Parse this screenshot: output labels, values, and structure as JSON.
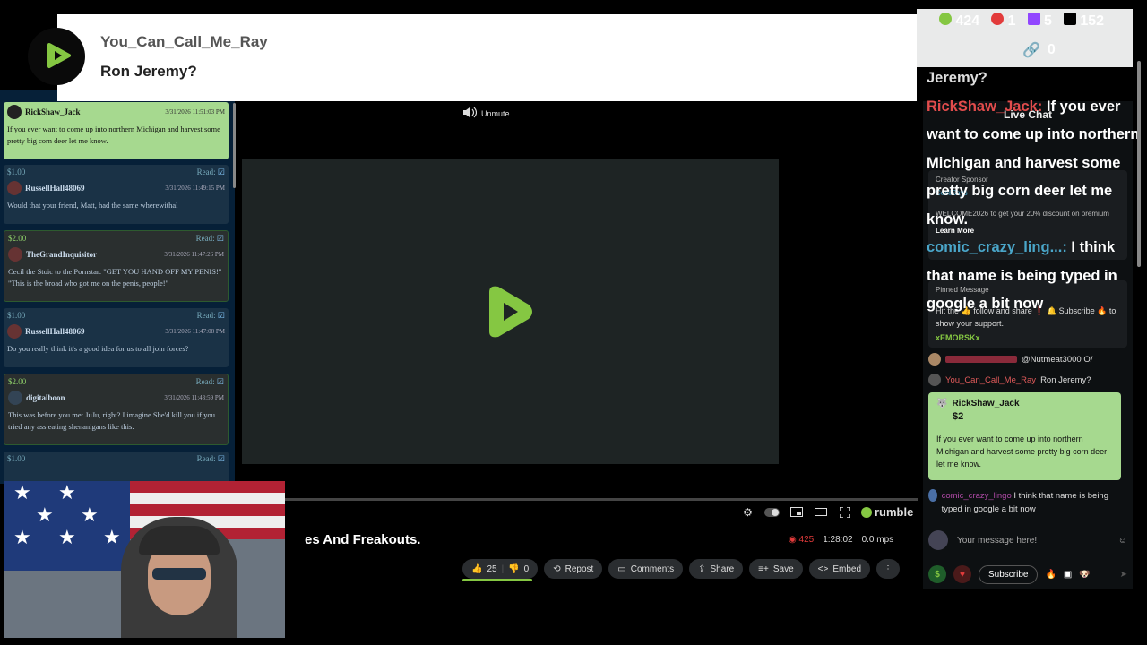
{
  "banner": {
    "username": "You_Can_Call_Me_Ray",
    "message": "Ron Jeremy?"
  },
  "top_stats": {
    "rumble_count": "424",
    "live_count": "1",
    "twitch_count": "5",
    "x_count": "152",
    "link_count": "0",
    "colors": {
      "rumble": "#85c742",
      "live": "#e23b3b",
      "twitch": "#9146ff",
      "x": "#000000"
    }
  },
  "player": {
    "unmute_label": "Unmute",
    "brand": "rumble",
    "title_partial": "es And Freakouts.",
    "viewers": "425",
    "duration": "1:28:02",
    "bitrate": "0.0 mps",
    "likes": "25",
    "dislikes": "0",
    "actions": [
      "Repost",
      "Comments",
      "Share",
      "Save",
      "Embed"
    ]
  },
  "donations": [
    {
      "amount": "$2.00",
      "user": "RickShaw_Jack",
      "time": "3/31/2026 11:51:03 PM",
      "message": "If you ever want to come up into northern Michigan and harvest some pretty big corn deer let me know.",
      "read": "",
      "style": "active"
    },
    {
      "amount": "$1.00",
      "user": "RussellHall48069",
      "time": "3/31/2026 11:49:15 PM",
      "message": "Would that your friend, Matt, had the same wherewithal",
      "read": "Read:",
      "style": "blue"
    },
    {
      "amount": "$2.00",
      "user": "TheGrandInquisitor",
      "time": "3/31/2026 11:47:26 PM",
      "message": "Cecil the Stoic to the Pornstar: \"GET YOU HAND OFF MY PENIS!\" \"This is the broad who got me on the penis, people!\"",
      "read": "Read:",
      "style": "green"
    },
    {
      "amount": "$1.00",
      "user": "RussellHall48069",
      "time": "3/31/2026 11:47:08 PM",
      "message": "Do you really think it's a good idea for us to all join forces?",
      "read": "Read:",
      "style": "blue"
    },
    {
      "amount": "$2.00",
      "user": "digitalboon",
      "time": "3/31/2026 11:43:59 PM",
      "message": "This was before you met JuJu, right? I imagine She'd kill you if you tried any ass eating shenanigans like this.",
      "read": "Read:",
      "style": "green"
    },
    {
      "amount": "$1.00",
      "user": "",
      "time": "",
      "message": "",
      "read": "Read:",
      "style": "blue"
    }
  ],
  "chat": {
    "header": "Live Chat",
    "sponsor_label": "Creator Sponsor",
    "sponsor_user": "CecilSays",
    "sponsor_text": "WELCOME2026 to get your 20% discount on premium",
    "sponsor_learn": "Learn More",
    "pinned_label": "Pinned Message",
    "pinned_text": "Hit the 👍 follow and share ❗ 🔔 Subscribe 🔥 to show your support.",
    "pinned_user": "xEMORSKx",
    "line1_text": "@Nutmeat3000 O/",
    "line2_user": "You_Can_Call_Me_Ray",
    "line2_text": "Ron Jeremy?",
    "rant_user": "RickShaw_Jack",
    "rant_amount": "$2",
    "rant_message": "If you ever want to come up into northern Michigan and harvest some pretty big corn deer let me know.",
    "line3_user": "comic_crazy_lingo",
    "line3_text": "I think that name is being typed in google a bit now",
    "input_placeholder": "Your message here!",
    "subscribe_label": "Subscribe",
    "dollar_label": "$"
  },
  "overlay_chat": {
    "faded_line": "Jeremy?",
    "user1": "RickShaw_Jack:",
    "msg1": "If you ever want to come up into northern Michigan and harvest some pretty big corn deer let me know.",
    "user2": "comic_crazy_ling...:",
    "msg2": "I think that name is being typed in google a bit now"
  }
}
